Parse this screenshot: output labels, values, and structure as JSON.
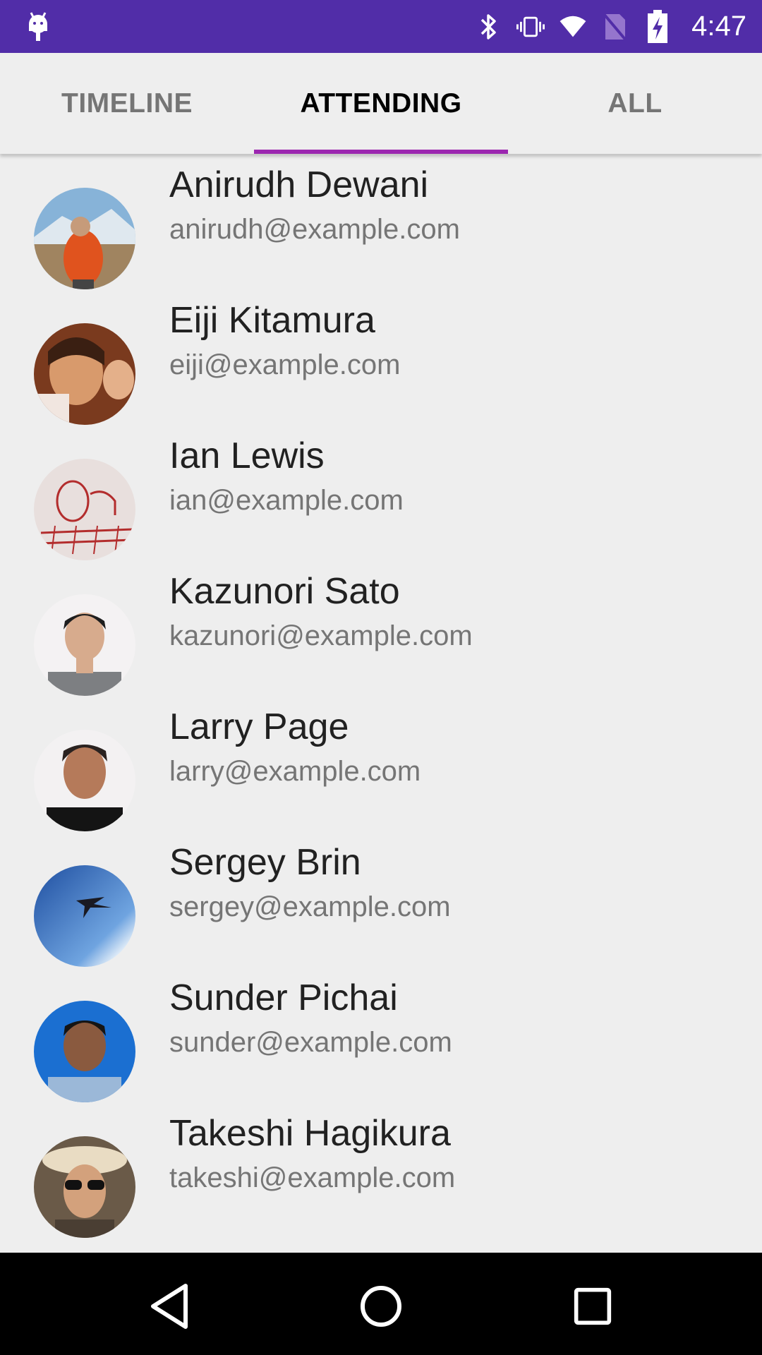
{
  "status_bar": {
    "time": "4:47",
    "icons": [
      "android-debug-icon",
      "bluetooth-icon",
      "vibrate-icon",
      "wifi-icon",
      "no-sim-icon",
      "battery-charging-icon"
    ]
  },
  "tabs": [
    {
      "label": "TIMELINE",
      "active": false
    },
    {
      "label": "ATTENDING",
      "active": true
    },
    {
      "label": "ALL",
      "active": false
    }
  ],
  "colors": {
    "status_bar": "#512da8",
    "tab_indicator": "#9c27b0",
    "background": "#eeeeee"
  },
  "attendees": [
    {
      "name": "Anirudh Dewani",
      "email": "anirudh@example.com"
    },
    {
      "name": "Eiji Kitamura",
      "email": "eiji@example.com"
    },
    {
      "name": "Ian Lewis",
      "email": "ian@example.com"
    },
    {
      "name": "Kazunori Sato",
      "email": "kazunori@example.com"
    },
    {
      "name": "Larry Page",
      "email": "larry@example.com"
    },
    {
      "name": "Sergey Brin",
      "email": "sergey@example.com"
    },
    {
      "name": "Sunder Pichai",
      "email": "sunder@example.com"
    },
    {
      "name": "Takeshi Hagikura",
      "email": "takeshi@example.com"
    }
  ],
  "nav_bar": {
    "icons": [
      "back-icon",
      "home-icon",
      "recents-icon"
    ]
  }
}
